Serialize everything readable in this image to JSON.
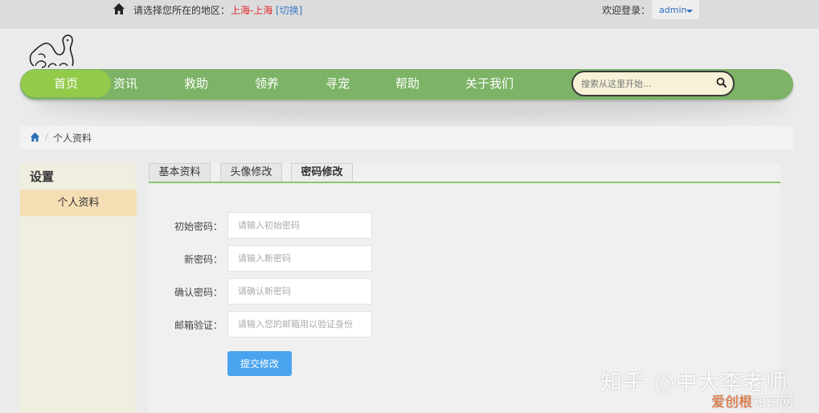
{
  "topbar": {
    "region_label": "请选择您所在的地区：",
    "region_value": "上海-上海",
    "region_switch": "[切换]",
    "welcome_label": "欢迎登录：",
    "username": "admin"
  },
  "nav": {
    "items": [
      {
        "label": "首页",
        "active": true
      },
      {
        "label": "资讯"
      },
      {
        "label": "救助"
      },
      {
        "label": "领养"
      },
      {
        "label": "寻宠"
      },
      {
        "label": "帮助"
      },
      {
        "label": "关于我们"
      }
    ],
    "search_placeholder": "搜索从这里开始..."
  },
  "breadcrumb": {
    "separator": "/",
    "current": "个人资料"
  },
  "sidebar": {
    "title": "设置",
    "items": [
      {
        "label": "个人资料",
        "active": true
      }
    ]
  },
  "tabs": [
    {
      "label": "基本资料"
    },
    {
      "label": "头像修改"
    },
    {
      "label": "密码修改",
      "active": true
    }
  ],
  "form": {
    "fields": [
      {
        "label": "初始密码：",
        "placeholder": "请输入初始密码"
      },
      {
        "label": "新密码：",
        "placeholder": "请输入新密码"
      },
      {
        "label": "确认密码：",
        "placeholder": "请确认新密码"
      },
      {
        "label": "邮箱验证：",
        "placeholder": "请输入您的邮箱用以验证身份"
      }
    ],
    "submit_label": "提交修改"
  },
  "watermark": {
    "line1": "知乎 @中大李老师",
    "line2_accent": "爱创根",
    "line2_rest": "知识网"
  },
  "colors": {
    "nav_green": "#7cb366",
    "nav_active": "#93ca4a",
    "region_red": "#e0282a",
    "link_blue": "#3a7cc6",
    "submit_blue": "#4aa3ef",
    "sidebar_active": "#f6deb4"
  }
}
